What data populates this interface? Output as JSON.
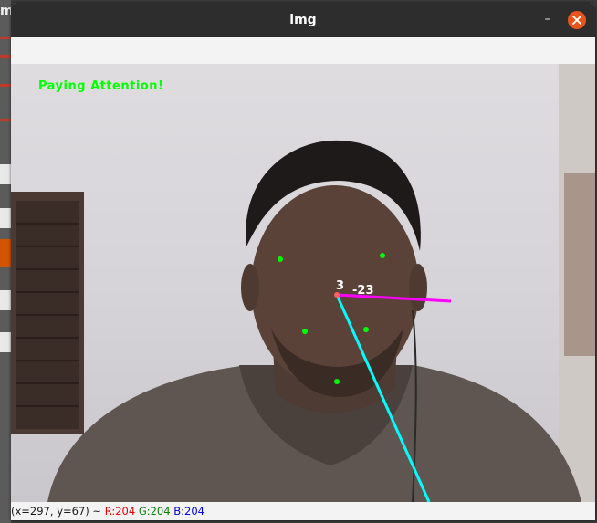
{
  "background_app": {
    "letter": "m"
  },
  "window": {
    "title": "img",
    "minimize_glyph": "–",
    "close_icon": "close-icon"
  },
  "canvas": {
    "status_text": "Paying Attention!",
    "angle_x": "3",
    "angle_y": "-23",
    "colors": {
      "status": "#00ff00",
      "landmark": "#00ff00",
      "pose_line_1": "#ff00ff",
      "pose_line_2": "#00ffff"
    }
  },
  "statusbar": {
    "coords": "(x=297, y=67) ~",
    "r_label": "R:204",
    "g_label": "G:204",
    "b_label": "B:204"
  }
}
